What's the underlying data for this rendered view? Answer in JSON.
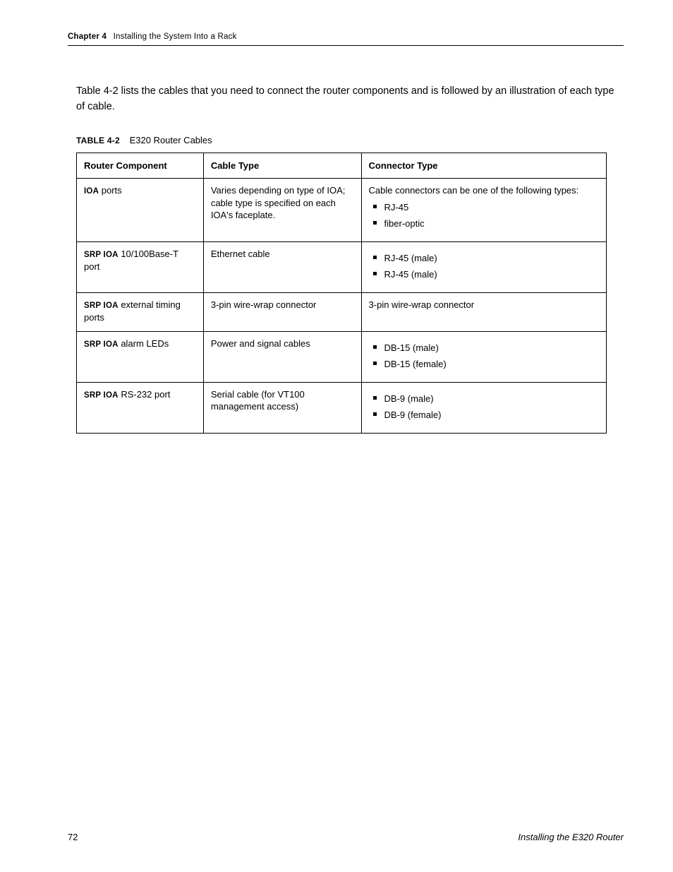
{
  "header": {
    "chapter_label": "Chapter 4",
    "chapter_title": "Installing the System Into a Rack"
  },
  "body": {
    "lead_text": "Table 4-2 lists the cables that you need to connect the router components and is followed by an illustration of each type of cable.",
    "table_caption_label": "TABLE 4-2",
    "table_caption_text": "E320 Router Cables"
  },
  "table": {
    "headers": [
      "Router Component",
      "Cable Type",
      "Connector Type"
    ],
    "rows": [
      {
        "component_label": "IOA",
        "component_text": " ports",
        "cable": "Varies depending on type of IOA; cable type is specified on each IOA's faceplate.",
        "connector_intro": "Cable connectors can be one of the following types:",
        "connector_items": [
          "RJ-45",
          "fiber-optic"
        ]
      },
      {
        "component_label": "SRP IOA",
        "component_text": " 10/100Base-T port",
        "cable": "Ethernet cable",
        "connector_intro": "",
        "connector_items": [
          "RJ-45 (male)",
          "RJ-45 (male)"
        ]
      },
      {
        "component_label": "SRP IOA",
        "component_text": " external timing ports",
        "cable": "3-pin wire-wrap connector",
        "connector_intro": "",
        "connector_items": [],
        "connector_plain": "3-pin wire-wrap connector"
      },
      {
        "component_label": "SRP IOA",
        "component_text": " alarm LEDs",
        "cable": "Power and signal cables",
        "connector_intro": "",
        "connector_items": [
          "DB-15 (male)",
          "DB-15 (female)"
        ]
      },
      {
        "component_label": "SRP IOA",
        "component_text": " RS-232 port",
        "cable": "Serial cable (for VT100 management access)",
        "connector_intro": "",
        "connector_items": [
          "DB-9 (male)",
          "DB-9 (female)"
        ]
      }
    ]
  },
  "footer": {
    "page": "72",
    "doc_title": "Installing the E320 Router"
  }
}
